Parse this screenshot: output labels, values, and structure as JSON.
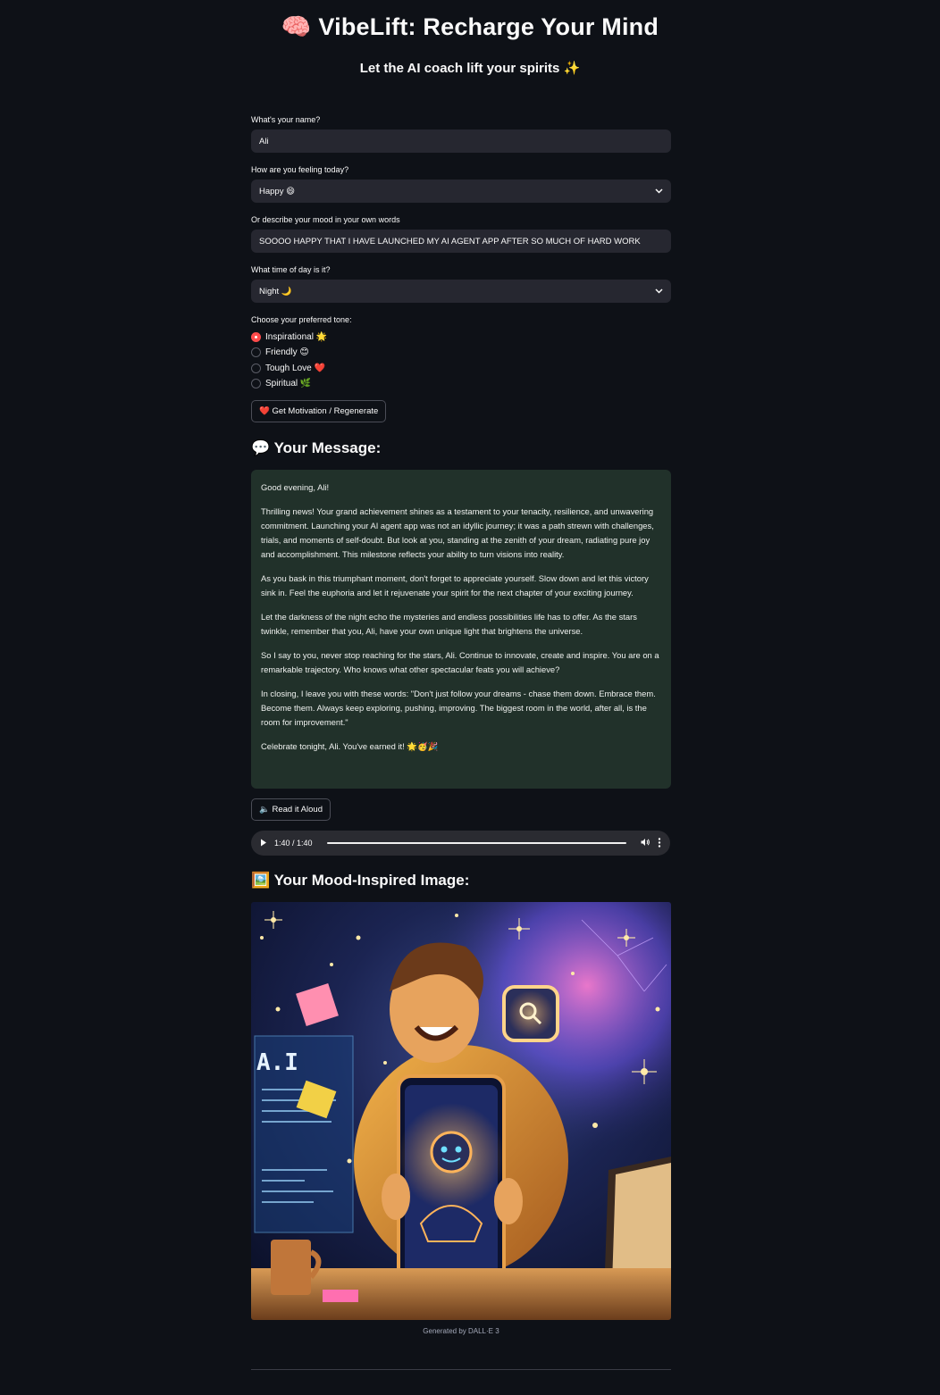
{
  "header": {
    "title": "🧠 VibeLift: Recharge Your Mind",
    "subtitle": "Let the AI coach lift your spirits ✨"
  },
  "form": {
    "name_label": "What's your name?",
    "name_value": "Ali",
    "feeling_label": "How are you feeling today?",
    "feeling_value": "Happy 😄",
    "describe_label": "Or describe your mood in your own words",
    "describe_value": "SOOOO HAPPY THAT I HAVE LAUNCHED MY AI AGENT APP AFTER SO MUCH OF HARD WORK",
    "time_label": "What time of day is it?",
    "time_value": "Night 🌙",
    "tone_label": "Choose your preferred tone:",
    "tones": [
      {
        "label": "Inspirational 🌟",
        "selected": true
      },
      {
        "label": "Friendly 😊",
        "selected": false
      },
      {
        "label": "Tough Love ❤️",
        "selected": false
      },
      {
        "label": "Spiritual 🌿",
        "selected": false
      }
    ],
    "motivation_button": "❤️ Get Motivation / Regenerate"
  },
  "message": {
    "heading": "💬 Your Message:",
    "paragraphs": [
      "Good evening, Ali!",
      "Thrilling news! Your grand achievement shines as a testament to your tenacity, resilience, and unwavering commitment. Launching your AI agent app was not an idyllic journey; it was a path strewn with challenges, trials, and moments of self-doubt. But look at you, standing at the zenith of your dream, radiating pure joy and accomplishment. This milestone reflects your ability to turn visions into reality.",
      "As you bask in this triumphant moment, don't forget to appreciate yourself. Slow down and let this victory sink in. Feel the euphoria and let it rejuvenate your spirit for the next chapter of your exciting journey.",
      "Let the darkness of the night echo the mysteries and endless possibilities life has to offer. As the stars twinkle, remember that you, Ali, have your own unique light that brightens the universe.",
      "So I say to you, never stop reaching for the stars, Ali. Continue to innovate, create and inspire. You are on a remarkable trajectory. Who knows what other spectacular feats you will achieve?",
      "In closing, I leave you with these words: \"Don't just follow your dreams - chase them down. Embrace them. Become them. Always keep exploring, pushing, improving. The biggest room in the world, after all, is the room for improvement.\"",
      "Celebrate tonight, Ali. You've earned it! 🌟🥳🎉"
    ],
    "read_button": "🔈 Read it Aloud"
  },
  "audio": {
    "time": "1:40 / 1:40",
    "progress": 1.0
  },
  "image_section": {
    "heading": "🖼️ Your Mood-Inspired Image:",
    "caption": "Generated by DALL·E 3",
    "screen_text": "A.I"
  },
  "colors": {
    "background": "#0e1117",
    "input": "#262730",
    "accent": "#ff4b4b",
    "message_bg": "#21312a"
  }
}
